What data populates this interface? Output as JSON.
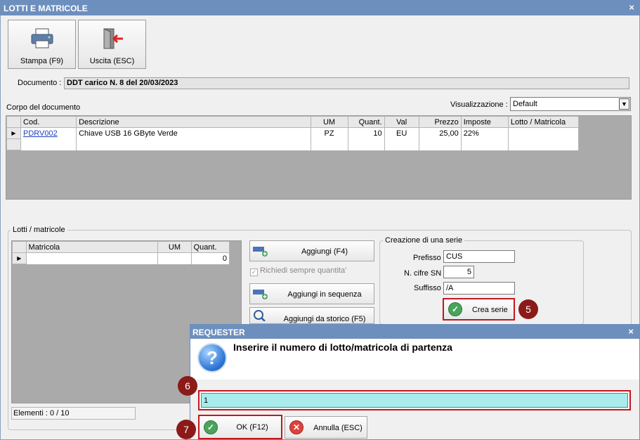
{
  "window": {
    "title": "LOTTI E MATRICOLE",
    "close": "×"
  },
  "toolbar": {
    "print_label": "Stampa (F9)",
    "exit_label": "Uscita (ESC)"
  },
  "document": {
    "label": "Documento :",
    "value": "DDT carico N. 8 del 20/03/2023"
  },
  "corpo": {
    "label": "Corpo del documento",
    "view_label": "Visualizzazione :",
    "view_value": "Default",
    "columns": [
      "Cod.",
      "Descrizione",
      "UM",
      "Quant.",
      "Val",
      "Prezzo",
      "Imposte",
      "Lotto / Matricola"
    ],
    "rows": [
      {
        "cod": "PDRV002",
        "descrizione": "Chiave USB 16 GByte Verde",
        "um": "PZ",
        "quant": "10",
        "val": "EU",
        "prezzo": "25,00",
        "imposte": "22%",
        "lotto": ""
      }
    ]
  },
  "lotti": {
    "legend": "Lotti / matricole",
    "columns": [
      "Matricola",
      "UM",
      "Quant."
    ],
    "row": {
      "matricola": "",
      "um": "",
      "quant": "0"
    },
    "status": "Elementi : 0 / 10"
  },
  "actions": {
    "add": "Aggiungi (F4)",
    "always_qty": "Richiedi sempre quantita'",
    "add_seq": "Aggiungi in sequenza",
    "add_history": "Aggiungi da storico (F5)"
  },
  "serie": {
    "legend": "Creazione di una serie",
    "prefix_label": "Prefisso",
    "prefix_value": "CUS",
    "digits_label": "N. cifre SN",
    "digits_value": "5",
    "suffix_label": "Suffisso",
    "suffix_value": "/A",
    "create_label": "Crea serie"
  },
  "requester": {
    "title": "REQUESTER",
    "close": "×",
    "message": "Inserire il numero di lotto/matricola di partenza",
    "input_value": "1",
    "ok_label": "OK (F12)",
    "cancel_label": "Annulla (ESC)"
  },
  "markers": {
    "m5": "5",
    "m6": "6",
    "m7": "7"
  },
  "colors": {
    "titlebar": "#6d8fbe",
    "highlight": "#c0181e",
    "marker": "#8b1a18",
    "input_bg": "#a8ecec"
  },
  "icons": [
    "printer-icon",
    "exit-door-icon",
    "question-icon",
    "check-icon",
    "cancel-icon",
    "search-icon"
  ]
}
